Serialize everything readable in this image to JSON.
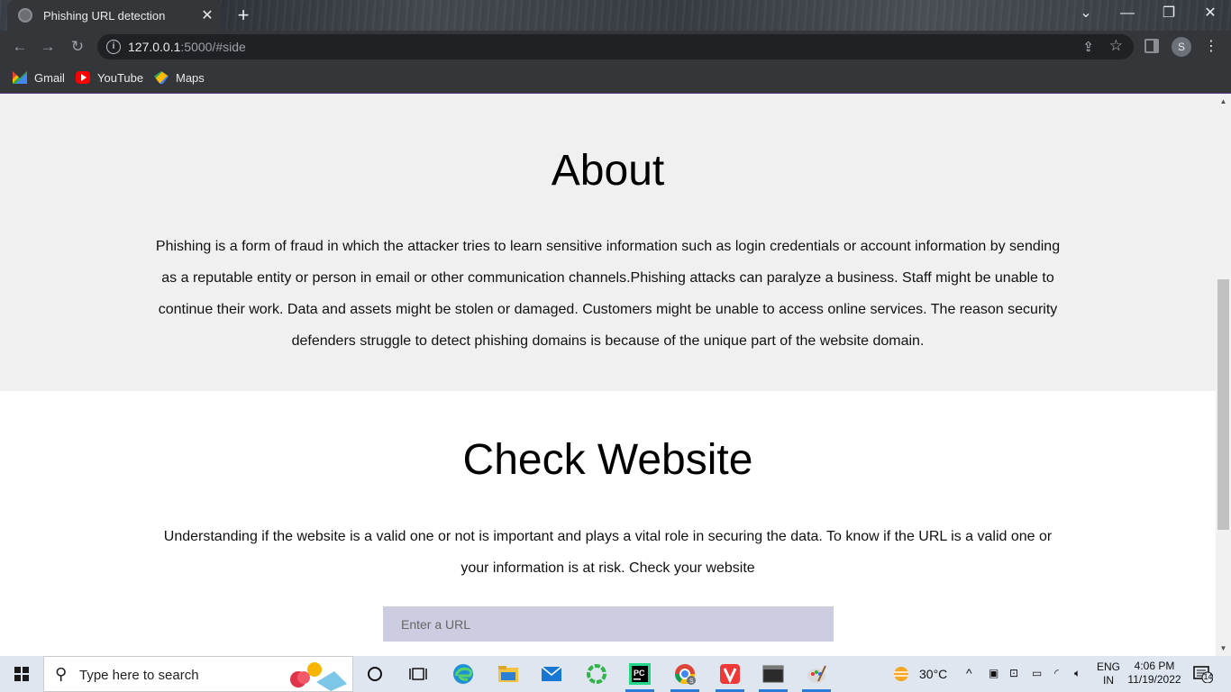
{
  "browser": {
    "tab_title": "Phishing URL detection",
    "tab_close": "✕",
    "new_tab": "+",
    "url_host": "127.0.0.1",
    "url_rest": ":5000/#side",
    "profile_initial": "S",
    "bookmarks": [
      {
        "label": "Gmail",
        "icon": "gmail-icon"
      },
      {
        "label": "YouTube",
        "icon": "youtube-icon"
      },
      {
        "label": "Maps",
        "icon": "maps-icon"
      }
    ]
  },
  "about": {
    "heading": "About",
    "body": "Phishing is a form of fraud in which the attacker tries to learn sensitive information such as login credentials or account information by sending as a reputable entity or person in email or other communication channels.Phishing attacks can paralyze a business. Staff might be unable to continue their work. Data and assets might be stolen or damaged. Customers might be unable to access online services. The reason security defenders struggle to detect phishing domains is because of the unique part of the website domain."
  },
  "check": {
    "heading": "Check Website",
    "body": "Understanding if the website is a valid one or not is important and plays a vital role in securing the data. To know if the URL is a valid one or your information is at risk. Check your website",
    "input_placeholder": "Enter a URL"
  },
  "taskbar": {
    "search_placeholder": "Type here to search",
    "weather_temp": "30°C",
    "language": "ENG",
    "region": "IN",
    "time": "4:06 PM",
    "date": "11/19/2022",
    "notification_count": "14"
  }
}
